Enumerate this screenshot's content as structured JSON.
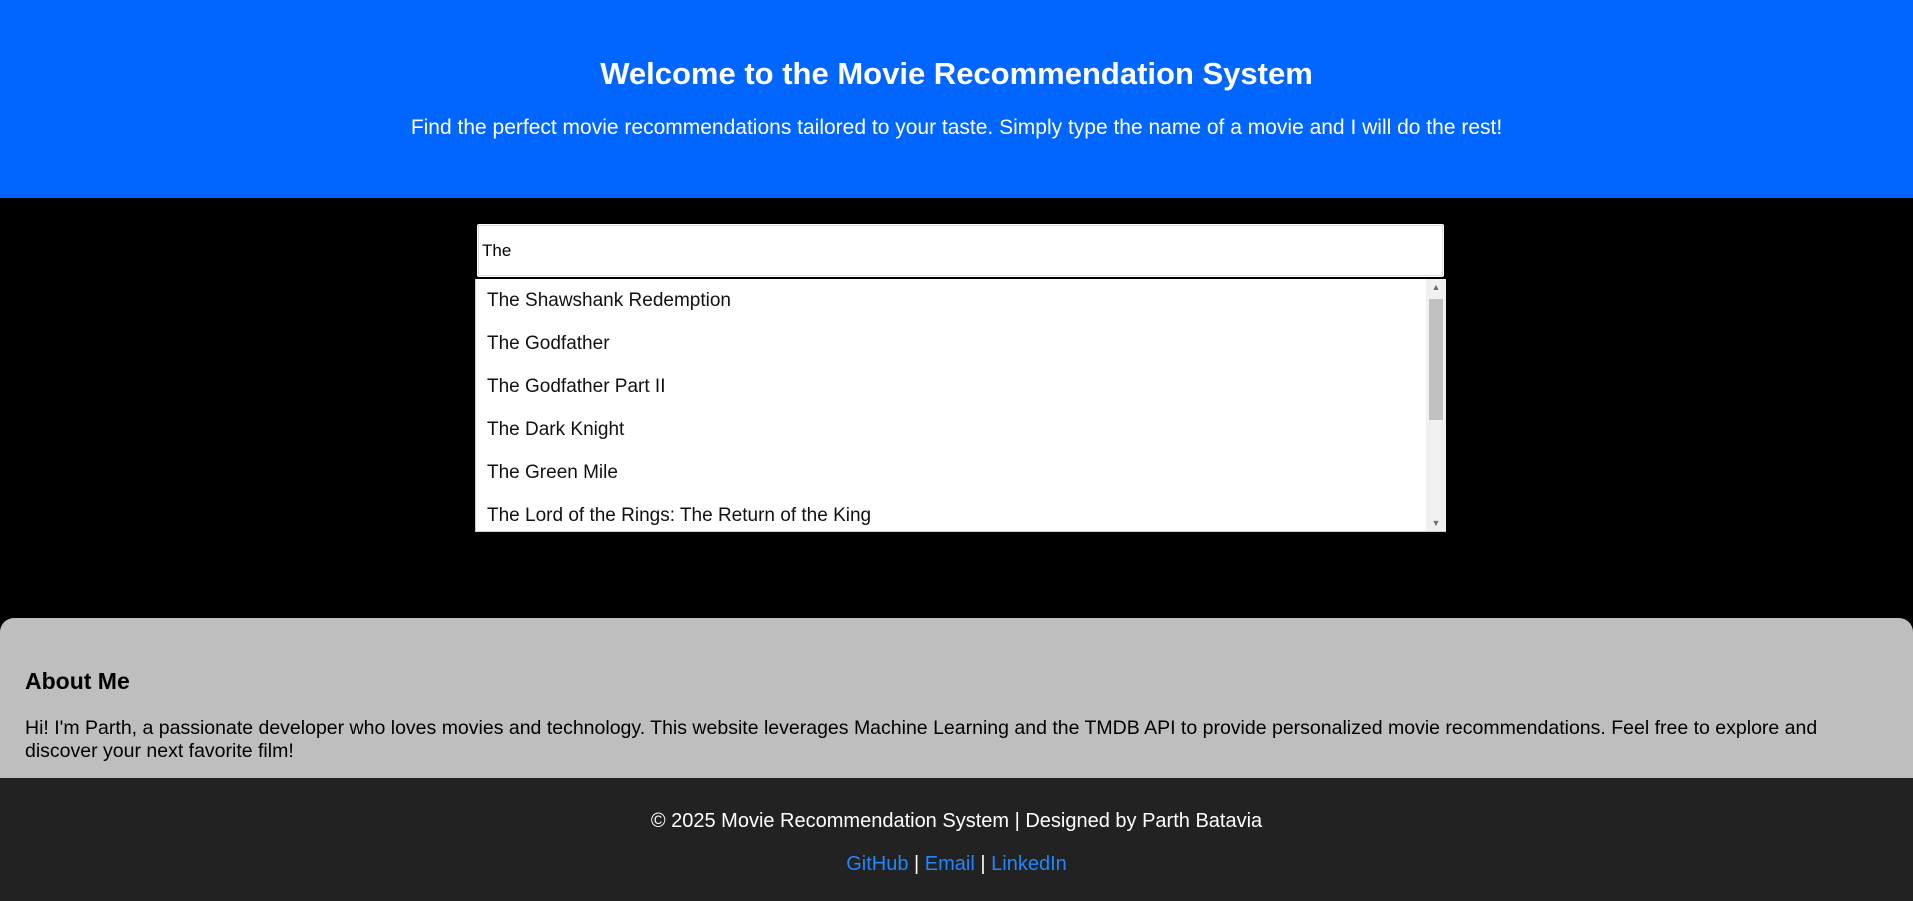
{
  "header": {
    "title": "Welcome to the Movie Recommendation System",
    "subtitle": "Find the perfect movie recommendations tailored to your taste. Simply type the name of a movie and I will do the rest!"
  },
  "search": {
    "value": "The"
  },
  "suggestions": [
    "The Shawshank Redemption",
    "The Godfather",
    "The Godfather Part II",
    "The Dark Knight",
    "The Green Mile",
    "The Lord of the Rings: The Return of the King"
  ],
  "about": {
    "title": "About Me",
    "text": "Hi! I'm Parth, a passionate developer who loves movies and technology. This website leverages Machine Learning and the TMDB API to provide personalized movie recommendations. Feel free to explore and discover your next favorite film!"
  },
  "footer": {
    "copyright": "© 2025 Movie Recommendation System | Designed by Parth Batavia",
    "links": {
      "github": "GitHub",
      "email": "Email",
      "linkedin": "LinkedIn",
      "separator": "|"
    }
  },
  "colors": {
    "header_bg": "#0066ff",
    "page_bg": "#000000",
    "about_bg": "#bebebe",
    "footer_bg": "#222222",
    "link": "#1e88ff"
  }
}
